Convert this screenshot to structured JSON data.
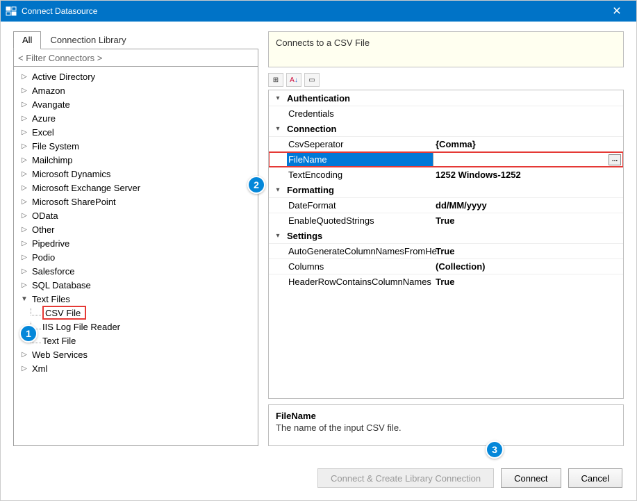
{
  "window": {
    "title": "Connect Datasource"
  },
  "tabs": {
    "all": "All",
    "library": "Connection Library"
  },
  "filter": {
    "placeholder": "< Filter Connectors >"
  },
  "tree": {
    "items": [
      "Active Directory",
      "Amazon",
      "Avangate",
      "Azure",
      "Excel",
      "File System",
      "Mailchimp",
      "Microsoft Dynamics",
      "Microsoft Exchange Server",
      "Microsoft SharePoint",
      "OData",
      "Other",
      "Pipedrive",
      "Podio",
      "Salesforce",
      "SQL Database"
    ],
    "textfiles": {
      "label": "Text Files",
      "children": [
        "CSV File",
        "IIS Log File Reader",
        "Text File"
      ]
    },
    "tail": [
      "Web Services",
      "Xml"
    ]
  },
  "desc": "Connects to a CSV File",
  "toolbar": {
    "cat": "⊞",
    "az": "A↓Z",
    "page": "▭"
  },
  "props": {
    "cats": [
      "Authentication",
      "Connection",
      "Formatting",
      "Settings"
    ],
    "auth": {
      "Credentials": ""
    },
    "conn": {
      "CsvSeperator": "{Comma}",
      "FileName": "",
      "TextEncoding": "1252    Windows-1252"
    },
    "fmt": {
      "DateFormat": "dd/MM/yyyy",
      "EnableQuotedStrings": "True"
    },
    "set": {
      "AutoGenerateColumnNamesFromHe": "True",
      "Columns": "(Collection)",
      "HeaderRowContainsColumnNames": "True"
    }
  },
  "labels": {
    "Credentials": "Credentials",
    "CsvSeperator": "CsvSeperator",
    "FileName": "FileName",
    "TextEncoding": "TextEncoding",
    "DateFormat": "DateFormat",
    "EnableQuotedStrings": "EnableQuotedStrings",
    "AutoGenerateColumnNamesFromHe": "AutoGenerateColumnNamesFromHe",
    "Columns": "Columns",
    "HeaderRowContainsColumnNames": "HeaderRowContainsColumnNames"
  },
  "help": {
    "name": "FileName",
    "desc": "The name of the input CSV file."
  },
  "buttons": {
    "createlib": "Connect & Create Library Connection",
    "connect": "Connect",
    "cancel": "Cancel"
  },
  "callouts": {
    "c1": "1",
    "c2": "2",
    "c3": "3"
  },
  "ellipsis": "..."
}
